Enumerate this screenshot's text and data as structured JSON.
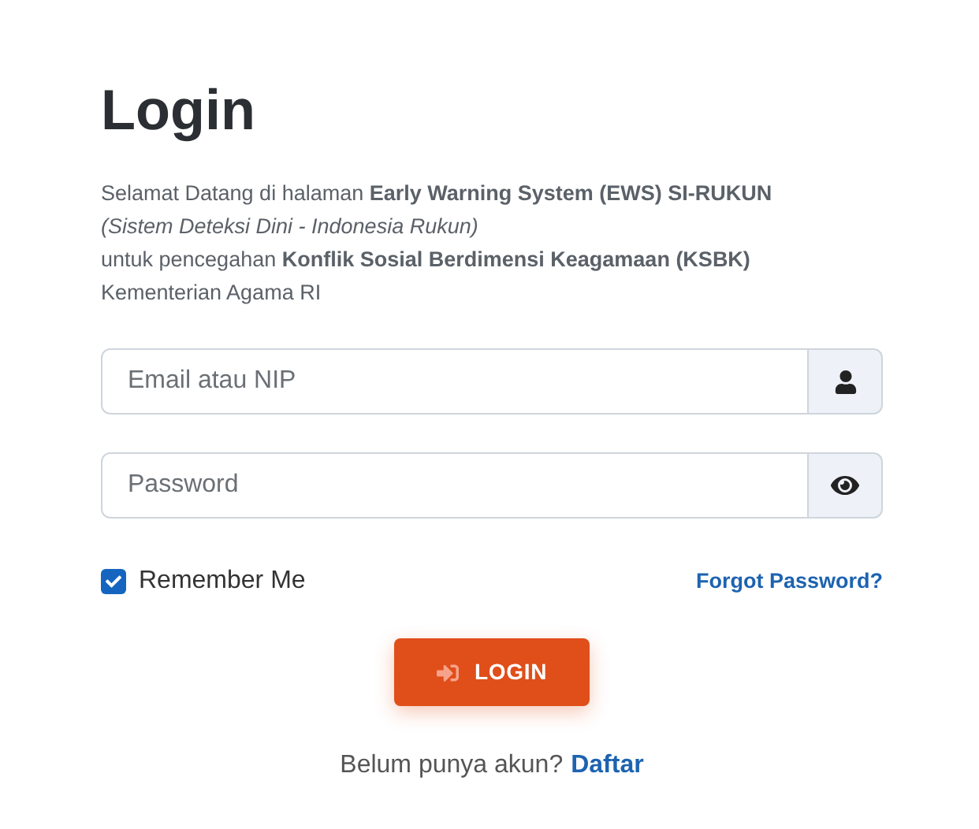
{
  "title": "Login",
  "intro": [
    {
      "text": "Selamat Datang di halaman **Early Warning System (EWS) SI-RUKUN**",
      "italic": false
    },
    {
      "text": "(Sistem Deteksi Dini - Indonesia Rukun)",
      "italic": true
    },
    {
      "text": "untuk pencegahan **Konflik Sosial Berdimensi Keagamaan (KSBK)**",
      "italic": false
    },
    {
      "text": "Kementerian Agama RI",
      "italic": false
    }
  ],
  "fields": [
    {
      "placeholder": "Email atau NIP",
      "kind": "user"
    },
    {
      "placeholder": "Password",
      "kind": "password"
    }
  ],
  "remember": {
    "label": "Remember Me",
    "checked": true
  },
  "forgot_link": "Forgot Password?",
  "login_button": "LOGIN",
  "footer": {
    "text": "Belum punya akun?",
    "link": "Daftar"
  }
}
